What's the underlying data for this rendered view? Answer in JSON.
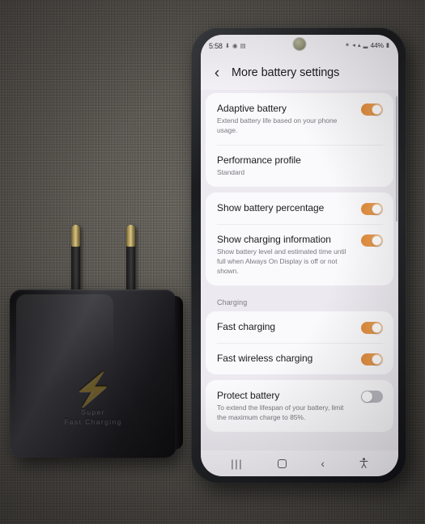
{
  "scene": {
    "description": "Samsung phone showing More battery settings next to a black Super Fast Charging wall adapter on grey woven fabric"
  },
  "charger": {
    "bolt_icon": "⚡",
    "emboss_line1": "Super",
    "emboss_line2": "Fast Charging"
  },
  "phone": {
    "status_bar": {
      "time": "5:58",
      "left_icons": [
        "download-icon",
        "location-icon",
        "calendar-icon"
      ],
      "left_glyphs": [
        "⬇",
        "◉",
        "▤"
      ],
      "right_icons": [
        "bluetooth-icon",
        "mute-icon",
        "wifi-icon",
        "signal-icon"
      ],
      "right_glyphs": [
        "✶",
        "◂",
        "▴",
        "▂"
      ],
      "battery_percent": "44%",
      "battery_icon": "▮"
    },
    "header": {
      "back_icon": "‹",
      "title": "More battery settings"
    },
    "sections": [
      {
        "label": "",
        "rows": [
          {
            "title": "Adaptive battery",
            "subtitle": "Extend battery life based on your phone usage.",
            "control": "toggle",
            "state": "on"
          },
          {
            "title": "Performance profile",
            "subtitle": "Standard",
            "control": "none",
            "state": ""
          }
        ]
      },
      {
        "label": "",
        "rows": [
          {
            "title": "Show battery percentage",
            "subtitle": "",
            "control": "toggle",
            "state": "on"
          },
          {
            "title": "Show charging information",
            "subtitle": "Show battery level and estimated time until full when Always On Display is off or not shown.",
            "control": "toggle",
            "state": "on"
          }
        ]
      },
      {
        "label": "Charging",
        "rows": [
          {
            "title": "Fast charging",
            "subtitle": "",
            "control": "toggle",
            "state": "on"
          },
          {
            "title": "Fast wireless charging",
            "subtitle": "",
            "control": "toggle",
            "state": "on"
          }
        ]
      },
      {
        "label": "",
        "rows": [
          {
            "title": "Protect battery",
            "subtitle": "To extend the lifespan of your battery, limit the maximum charge to 85%.",
            "control": "toggle",
            "state": "off"
          }
        ]
      }
    ],
    "nav_bar": {
      "recents_glyph": "|||",
      "home_label": "home-square",
      "back_glyph": "‹",
      "accessibility_glyph": "ᾜD"
    }
  },
  "colors": {
    "toggle_on": "#e08b3c",
    "toggle_off": "#b9b8bf",
    "card_bg": "#faf9fb",
    "screen_bg": "#eceaf0"
  }
}
